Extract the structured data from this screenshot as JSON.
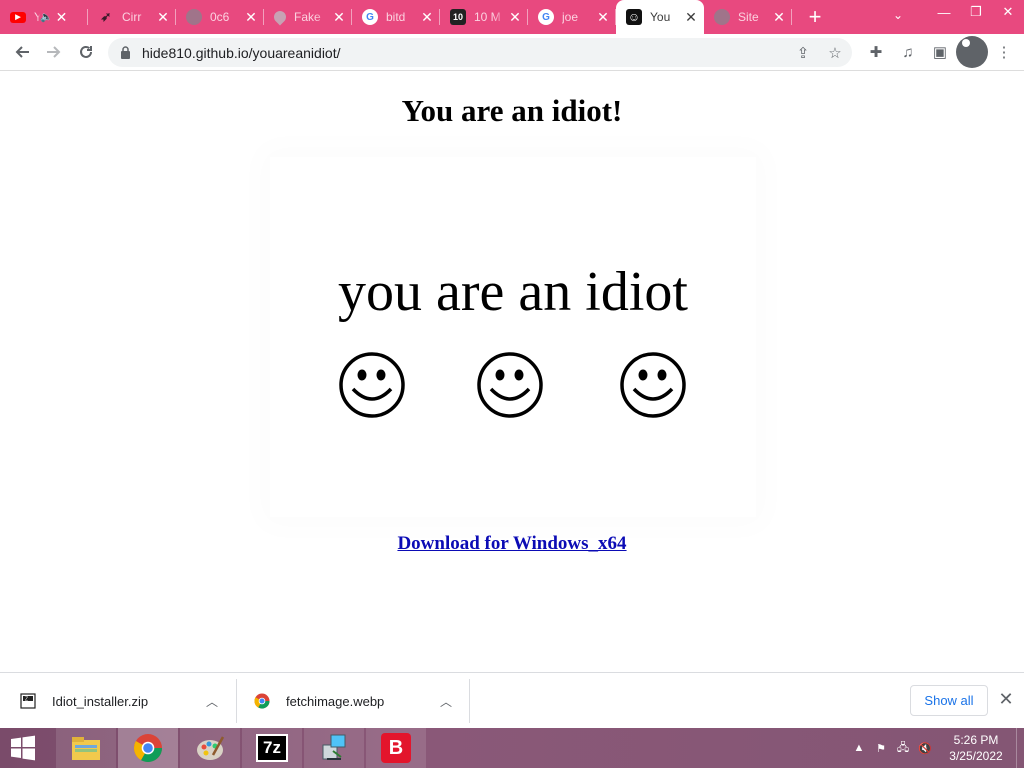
{
  "browser": {
    "tabs": [
      {
        "title": "YouTube",
        "favicon": "youtube-icon",
        "muted": true,
        "active": false
      },
      {
        "title": "Cirr",
        "favicon": "bird-icon",
        "active": false
      },
      {
        "title": "0c6",
        "favicon": "globe-icon",
        "active": false
      },
      {
        "title": "Fake",
        "favicon": "map-pin-icon",
        "active": false
      },
      {
        "title": "bitd",
        "favicon": "google-icon",
        "active": false
      },
      {
        "title": "10 M",
        "favicon": "ten-icon",
        "active": false
      },
      {
        "title": "joe",
        "favicon": "google-icon",
        "active": false
      },
      {
        "title": "You",
        "favicon": "smiley-icon",
        "active": true
      },
      {
        "title": "Site",
        "favicon": "globe-icon",
        "active": false
      }
    ],
    "new_tab": "+",
    "address": "hide810.github.io/youareanidiot/"
  },
  "page": {
    "title": "You are an idiot!",
    "banner_text": "you are an idiot",
    "download_link": "Download for Windows_x64"
  },
  "downloads": {
    "items": [
      {
        "name": "Idiot_installer.zip",
        "icon": "zip-file-icon"
      },
      {
        "name": "fetchimage.webp",
        "icon": "chrome-file-icon"
      }
    ],
    "show_all": "Show all"
  },
  "taskbar": {
    "apps": [
      "file-explorer-icon",
      "chrome-icon",
      "paint-icon",
      "7zip-icon",
      "network-app-icon",
      "bitdefender-icon"
    ],
    "seven_zip_label": "7z",
    "bitdefender_label": "B",
    "time": "5:26 PM",
    "date": "3/25/2022"
  },
  "colors": {
    "tabstrip": "#e8497f",
    "link": "#0b0bb5",
    "taskbar": "#845674"
  }
}
